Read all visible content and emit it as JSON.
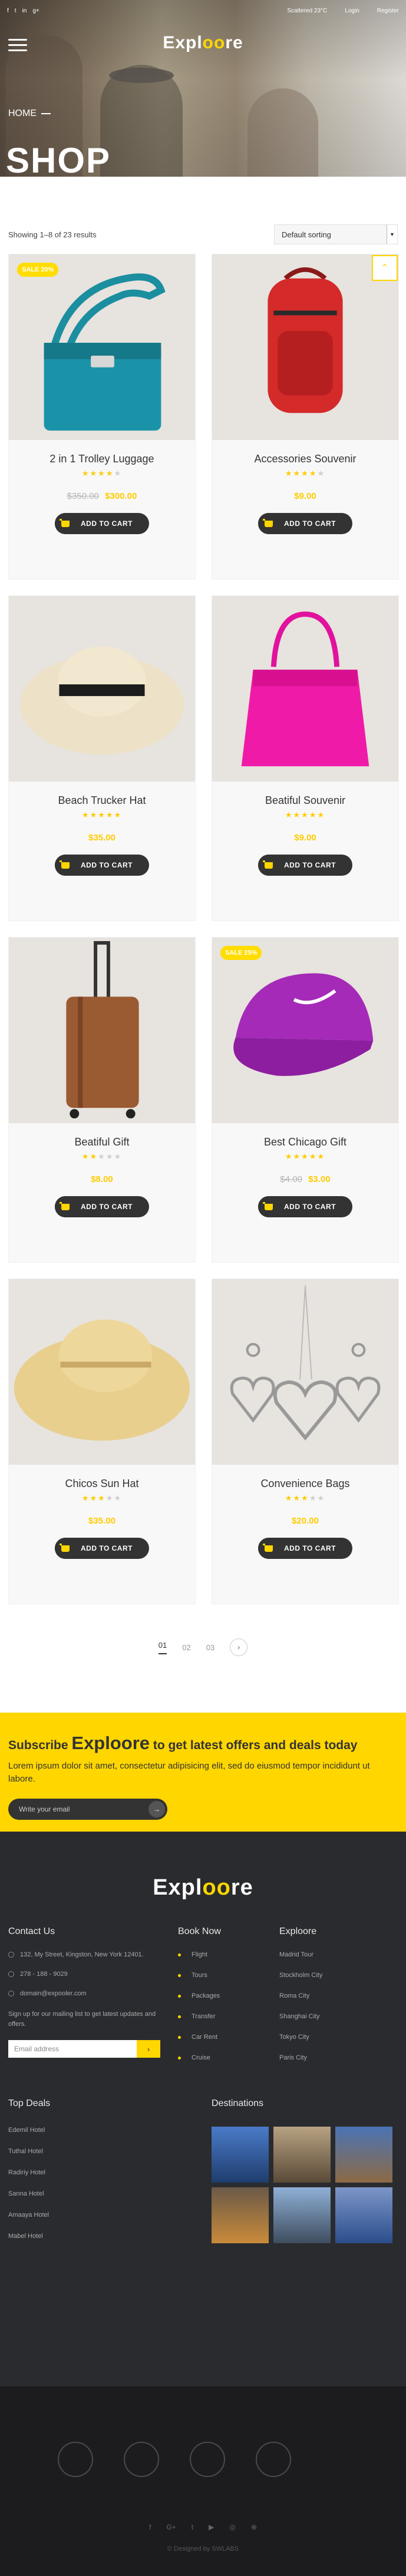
{
  "topbar": {
    "social_icons": [
      "f",
      "t",
      "in",
      "g+"
    ],
    "weather": "Scattered 23°C",
    "login": "Login",
    "register": "Register"
  },
  "hero": {
    "logo_left": "Expl",
    "logo_oo": "oo",
    "logo_right": "re",
    "breadcrumb": "HOME",
    "title": "SHOP"
  },
  "shop": {
    "result_count": "Showing 1–8 of 23 results",
    "sort_selected": "Default sorting"
  },
  "products": [
    {
      "name": "2 in 1 Trolley Luggage",
      "rating": 4,
      "old_price": "$350.00",
      "price": "$300.00",
      "sale": "SALE 20%",
      "button": "ADD TO CART"
    },
    {
      "name": "Accessories Souvenir",
      "rating": 4,
      "old_price": "",
      "price": "$9.00",
      "sale": "",
      "button": "ADD TO CART"
    },
    {
      "name": "Beach Trucker Hat",
      "rating": 5,
      "old_price": "",
      "price": "$35.00",
      "sale": "",
      "button": "ADD TO CART"
    },
    {
      "name": "Beatiful Souvenir",
      "rating": 5,
      "old_price": "",
      "price": "$9.00",
      "sale": "",
      "button": "ADD TO CART"
    },
    {
      "name": "Beatiful Gift",
      "rating": 2,
      "old_price": "",
      "price": "$8.00",
      "sale": "",
      "button": "ADD TO CART"
    },
    {
      "name": "Best Chicago Gift",
      "rating": 5,
      "old_price": "$4.00",
      "price": "$3.00",
      "sale": "SALE 25%",
      "button": "ADD TO CART"
    },
    {
      "name": "Chicos Sun Hat",
      "rating": 3,
      "old_price": "",
      "price": "$35.00",
      "sale": "",
      "button": "ADD TO CART"
    },
    {
      "name": "Convenience Bags",
      "rating": 3,
      "old_price": "",
      "price": "$20.00",
      "sale": "",
      "button": "ADD TO CART"
    }
  ],
  "pagination": {
    "pages": [
      "01",
      "02",
      "03"
    ],
    "next": "›"
  },
  "subscribe": {
    "prefix": "Subscribe",
    "brand": "Exploore",
    "suffix": "to get latest offers and deals today",
    "text": "Lorem ipsum dolor sit amet, consectetur adipisicing elit, sed do eiusmod tempor incididunt ut labore.",
    "placeholder": "Write your email"
  },
  "footer": {
    "logo_left": "Expl",
    "logo_oo": "oo",
    "logo_right": "re",
    "contact_title": "Contact Us",
    "address": "132, My Street, Kingston, New York 12401.",
    "phone": "278 - 188 - 9029",
    "email": "domain@expooler.com",
    "signup": "Sign up for our mailing list to get latest updates and offers.",
    "email_placeholder": "Email address",
    "book_title": "Book Now",
    "book_items": [
      "Flight",
      "Tours",
      "Packages",
      "Transfer",
      "Car Rent",
      "Cruise"
    ],
    "exploore_title": "Exploore",
    "exploore_items": [
      "Madrid Tour",
      "Stockholm City",
      "Roma City",
      "Shanghai City",
      "Tokyo City",
      "Paris City"
    ],
    "top_deals_title": "Top Deals",
    "top_deals": [
      "Edemil Hotel",
      "Tuthal Hotel",
      "Radiriy Hotel",
      "Sanna Hotel",
      "Amaaya Hotel",
      "Mabel Hotel"
    ],
    "destinations_title": "Destinations",
    "destination_colors": [
      "#2c5aa0",
      "#8a7560",
      "#3a5a8c",
      "#5a4a38",
      "#7a8ea8",
      "#6a7fa8"
    ],
    "social_icons": [
      "f",
      "G+",
      "t",
      "▶",
      "◎",
      "⊕"
    ],
    "copyright": "© Designed by SWLABS"
  },
  "colors": {
    "accent": "#ffd600",
    "dark": "#2a2b2f",
    "card_bg": "#f8f8f8"
  }
}
